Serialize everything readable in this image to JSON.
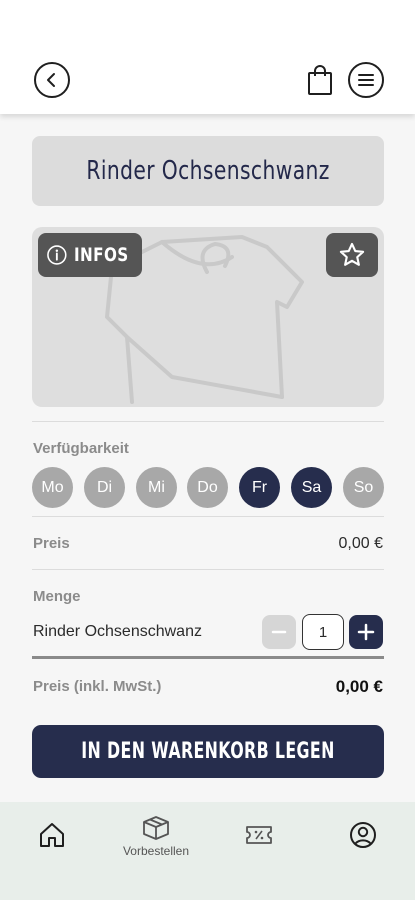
{
  "product": {
    "title": "Rinder Ochsenschwanz",
    "infos_label": "INFOS"
  },
  "availability": {
    "label": "Verfügbarkeit",
    "days": [
      {
        "label": "Mo",
        "active": false
      },
      {
        "label": "Di",
        "active": false
      },
      {
        "label": "Mi",
        "active": false
      },
      {
        "label": "Do",
        "active": false
      },
      {
        "label": "Fr",
        "active": true
      },
      {
        "label": "Sa",
        "active": true
      },
      {
        "label": "So",
        "active": false
      }
    ]
  },
  "price": {
    "label": "Preis",
    "value": "0,00 €"
  },
  "quantity": {
    "label": "Menge",
    "item_name": "Rinder Ochsenschwanz",
    "value": "1"
  },
  "total": {
    "label": "Preis (inkl. MwSt.)",
    "value": "0,00 €"
  },
  "cart_button_label": "IN DEN WARENKORB LEGEN",
  "bottom_nav": {
    "preorder_label": "Vorbestellen"
  },
  "colors": {
    "accent": "#262d4d",
    "day_inactive": "#a8a8a8",
    "nav_background": "#e8eeea"
  }
}
